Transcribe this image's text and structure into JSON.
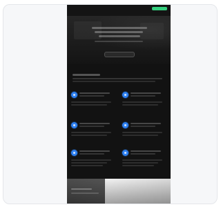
{
  "preview": {
    "screenshot": {
      "topbar": {
        "logo_text": "",
        "cta_label": ""
      },
      "hero": {
        "headline": "",
        "subheadline": "",
        "button_label": ""
      },
      "features_section": {
        "title": "",
        "description": "",
        "items": [
          {
            "icon": "feature-icon"
          },
          {
            "icon": "feature-icon"
          },
          {
            "icon": "feature-icon"
          },
          {
            "icon": "feature-icon"
          },
          {
            "icon": "feature-icon"
          },
          {
            "icon": "feature-icon"
          }
        ]
      },
      "footer_image": {
        "caption": ""
      },
      "colors": {
        "accent_green": "#35d07f",
        "accent_blue": "#2d7ff0",
        "background_dark": "#121212"
      }
    }
  }
}
